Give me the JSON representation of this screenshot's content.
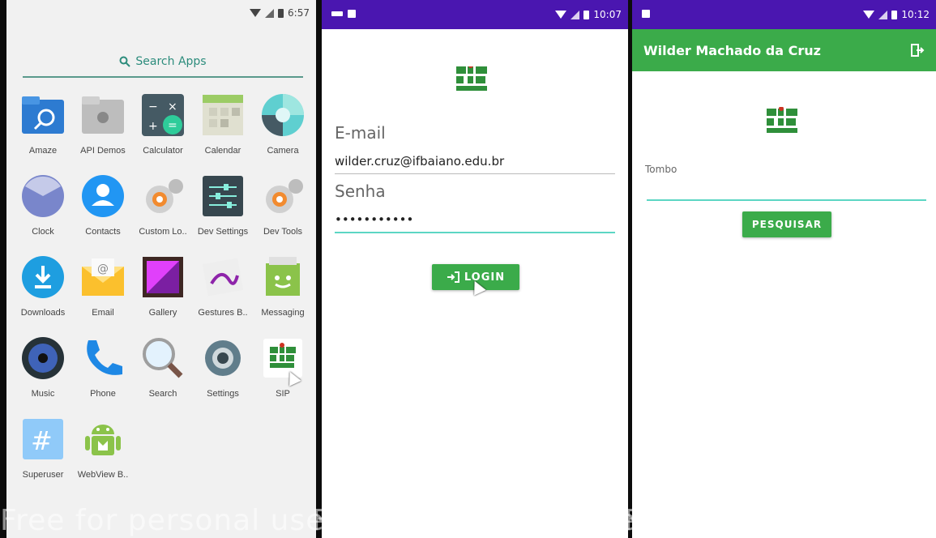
{
  "launcher": {
    "status_time": "6:57",
    "search_label": "Search Apps",
    "apps": [
      {
        "label": "Amaze",
        "icon": "folder-search-icon"
      },
      {
        "label": "API Demos",
        "icon": "folder-gear-icon"
      },
      {
        "label": "Calculator",
        "icon": "calculator-icon"
      },
      {
        "label": "Calendar",
        "icon": "calendar-icon"
      },
      {
        "label": "Camera",
        "icon": "camera-icon"
      },
      {
        "label": "Clock",
        "icon": "clock-icon"
      },
      {
        "label": "Contacts",
        "icon": "contacts-icon"
      },
      {
        "label": "Custom Lo..",
        "icon": "gears-icon"
      },
      {
        "label": "Dev Settings",
        "icon": "dev-settings-icon"
      },
      {
        "label": "Dev Tools",
        "icon": "gears-icon"
      },
      {
        "label": "Downloads",
        "icon": "download-icon"
      },
      {
        "label": "Email",
        "icon": "email-icon"
      },
      {
        "label": "Gallery",
        "icon": "gallery-icon"
      },
      {
        "label": "Gestures B..",
        "icon": "gestures-icon"
      },
      {
        "label": "Messaging",
        "icon": "messaging-icon"
      },
      {
        "label": "Music",
        "icon": "music-icon"
      },
      {
        "label": "Phone",
        "icon": "phone-icon"
      },
      {
        "label": "Search",
        "icon": "magnifier-icon"
      },
      {
        "label": "Settings",
        "icon": "settings-gear-icon"
      },
      {
        "label": "SIP",
        "icon": "sip-logo-icon"
      },
      {
        "label": "Superuser",
        "icon": "superuser-icon"
      },
      {
        "label": "WebView B..",
        "icon": "android-icon"
      }
    ]
  },
  "login": {
    "status_time": "10:07",
    "email_label": "E-mail",
    "email_value": "wilder.cruz@ifbaiano.edu.br",
    "password_label": "Senha",
    "password_value": "•••••••••••",
    "login_button": "LOGIN"
  },
  "search_screen": {
    "status_time": "10:12",
    "title": "Wilder Machado da Cruz",
    "tombo_label": "Tombo",
    "tombo_value": "",
    "search_button": "PESQUISAR"
  },
  "watermark": "Free for personal use",
  "colors": {
    "accent_green": "#3bab4a",
    "status_purple": "#4a16b0",
    "teal": "#2c8c7c"
  }
}
